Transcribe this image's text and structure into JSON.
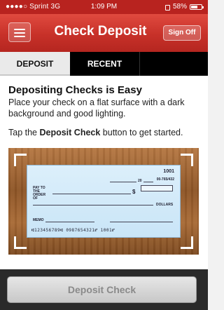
{
  "status_bar": {
    "carrier": "●●●●○ Sprint 3G",
    "time": "1:09 PM",
    "battery_percent": "58%"
  },
  "nav": {
    "title": "Check Deposit",
    "sign_off_label": "Sign Off"
  },
  "tabs": [
    {
      "label": "DEPOSIT",
      "selected": true
    },
    {
      "label": "RECENT",
      "selected": false
    }
  ],
  "content": {
    "heading": "Depositing Checks is Easy",
    "instructions": "Place your check on a flat surface with a dark background and good lighting.",
    "tap_prefix": "Tap the ",
    "tap_bold": "Deposit Check",
    "tap_suffix": " button to get started."
  },
  "check_image": {
    "check_number": "1001",
    "routing_fraction": "00-765/432",
    "year_prefix": "20",
    "pay_to_label": "PAY TO THE ORDER OF",
    "dollar_sign": "$",
    "dollars_label": "DOLLARS",
    "memo_label": "MEMO",
    "micr_line": "⑆123456789⑆ 0987654321⑈ 1001⑈"
  },
  "bottom": {
    "deposit_button_label": "Deposit Check"
  },
  "colors": {
    "header_red": "#c73129",
    "tab_bar_black": "#000000",
    "check_blue": "#c9e5f7",
    "wood_brown": "#8e5526"
  }
}
